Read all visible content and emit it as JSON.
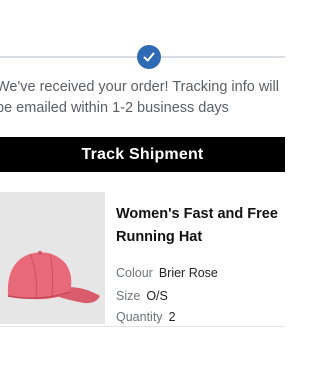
{
  "status": {
    "message_line1": "We've received your order! Tracking info will",
    "message_line2": "be emailed within 1-2 business days"
  },
  "track_button": {
    "label": "Track Shipment"
  },
  "product": {
    "name": "Women's Fast and Free Running Hat",
    "colour_label": "Colour",
    "colour_value": "Brier Rose",
    "size_label": "Size",
    "size_value": "O/S",
    "quantity_label": "Quantity",
    "quantity_value": "2"
  },
  "colors": {
    "accent": "#2f6ab4",
    "button": "#000000",
    "hat": "#e8697a"
  }
}
